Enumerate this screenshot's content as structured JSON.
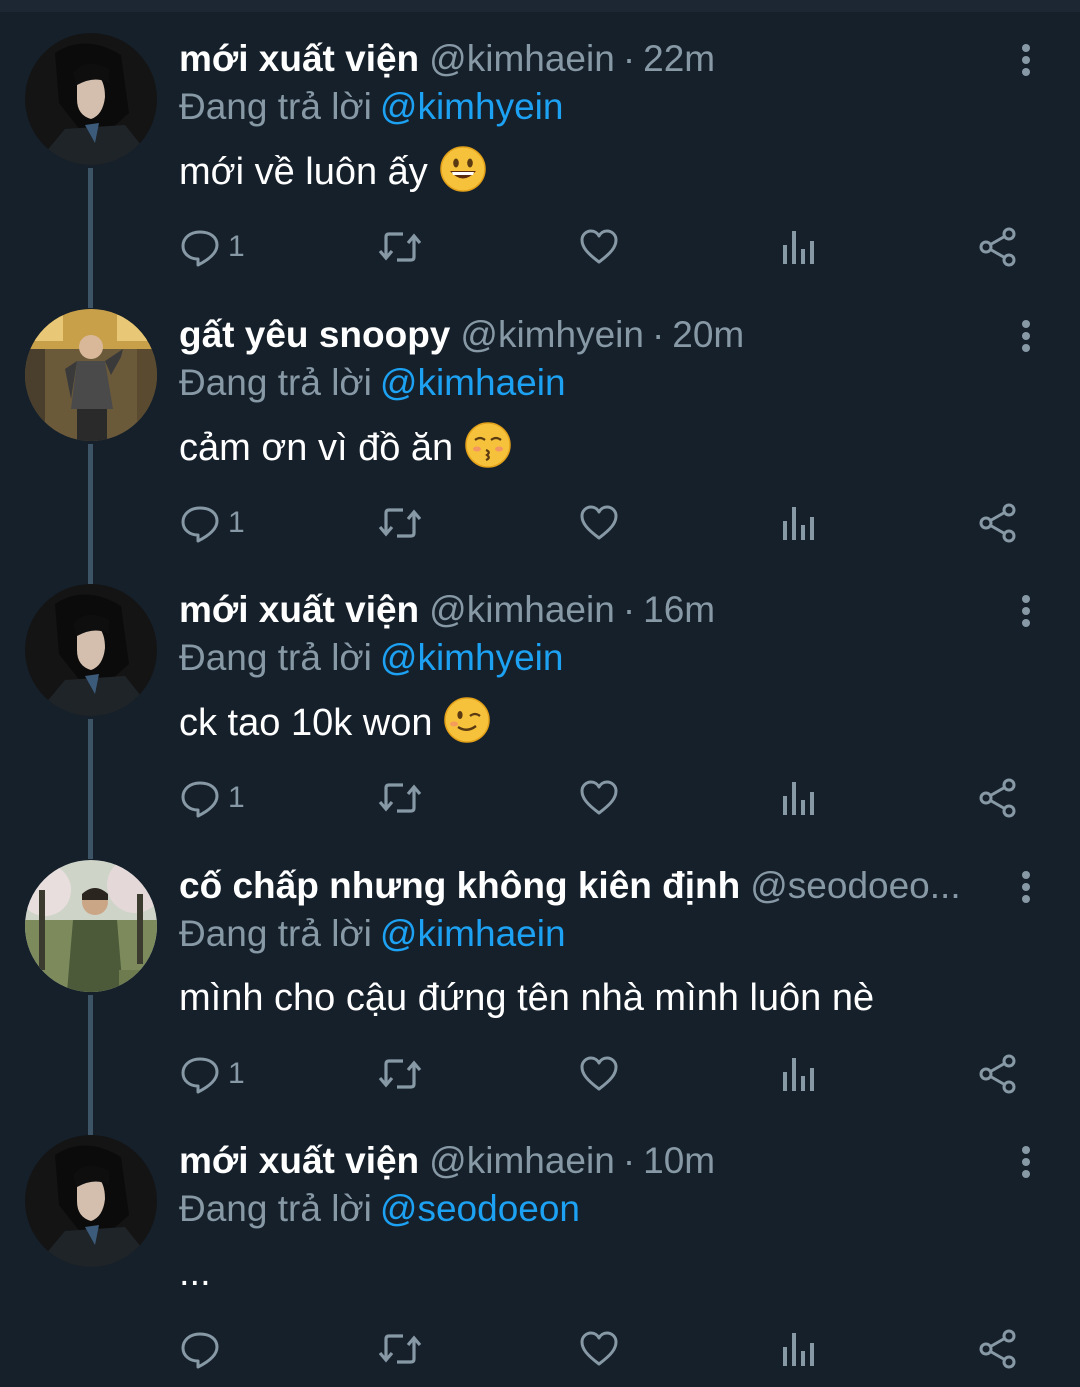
{
  "tweets": [
    {
      "name": "mới xuất viện",
      "handle": "@kimhaein",
      "time": "22m",
      "reply_prefix": "Đang trả lời",
      "reply_to": "@kimhyein",
      "text": "mới về luôn ấy",
      "emoji": "grinning-face",
      "reply_count": "1",
      "avatar": "dark-portrait"
    },
    {
      "name": "gất yêu snoopy",
      "handle": "@kimhyein",
      "time": "20m",
      "reply_prefix": "Đang trả lời",
      "reply_to": "@kimhaein",
      "text": "cảm ơn vì đồ ăn",
      "emoji": "kissing-face",
      "reply_count": "1",
      "avatar": "train-photo"
    },
    {
      "name": "mới xuất viện",
      "handle": "@kimhaein",
      "time": "16m",
      "reply_prefix": "Đang trả lời",
      "reply_to": "@kimhyein",
      "text": "ck tao 10k won",
      "emoji": "winking-face",
      "reply_count": "1",
      "avatar": "dark-portrait"
    },
    {
      "name": "cố chấp nhưng không kiên định",
      "handle": "@seodoeo...",
      "time": "",
      "reply_prefix": "Đang trả lời",
      "reply_to": "@kimhaein",
      "text": "mình cho cậu đứng tên nhà mình luôn nè",
      "emoji": "",
      "reply_count": "1",
      "avatar": "park-photo"
    },
    {
      "name": "mới xuất viện",
      "handle": "@kimhaein",
      "time": "10m",
      "reply_prefix": "Đang trả lời",
      "reply_to": "@seodoeon",
      "text": "...",
      "emoji": "",
      "reply_count": "",
      "avatar": "dark-portrait"
    }
  ],
  "colors": {
    "background": "#15202b",
    "secondary_text": "#8899a6",
    "mention": "#1da1f2",
    "thread_line": "#3d5466"
  }
}
